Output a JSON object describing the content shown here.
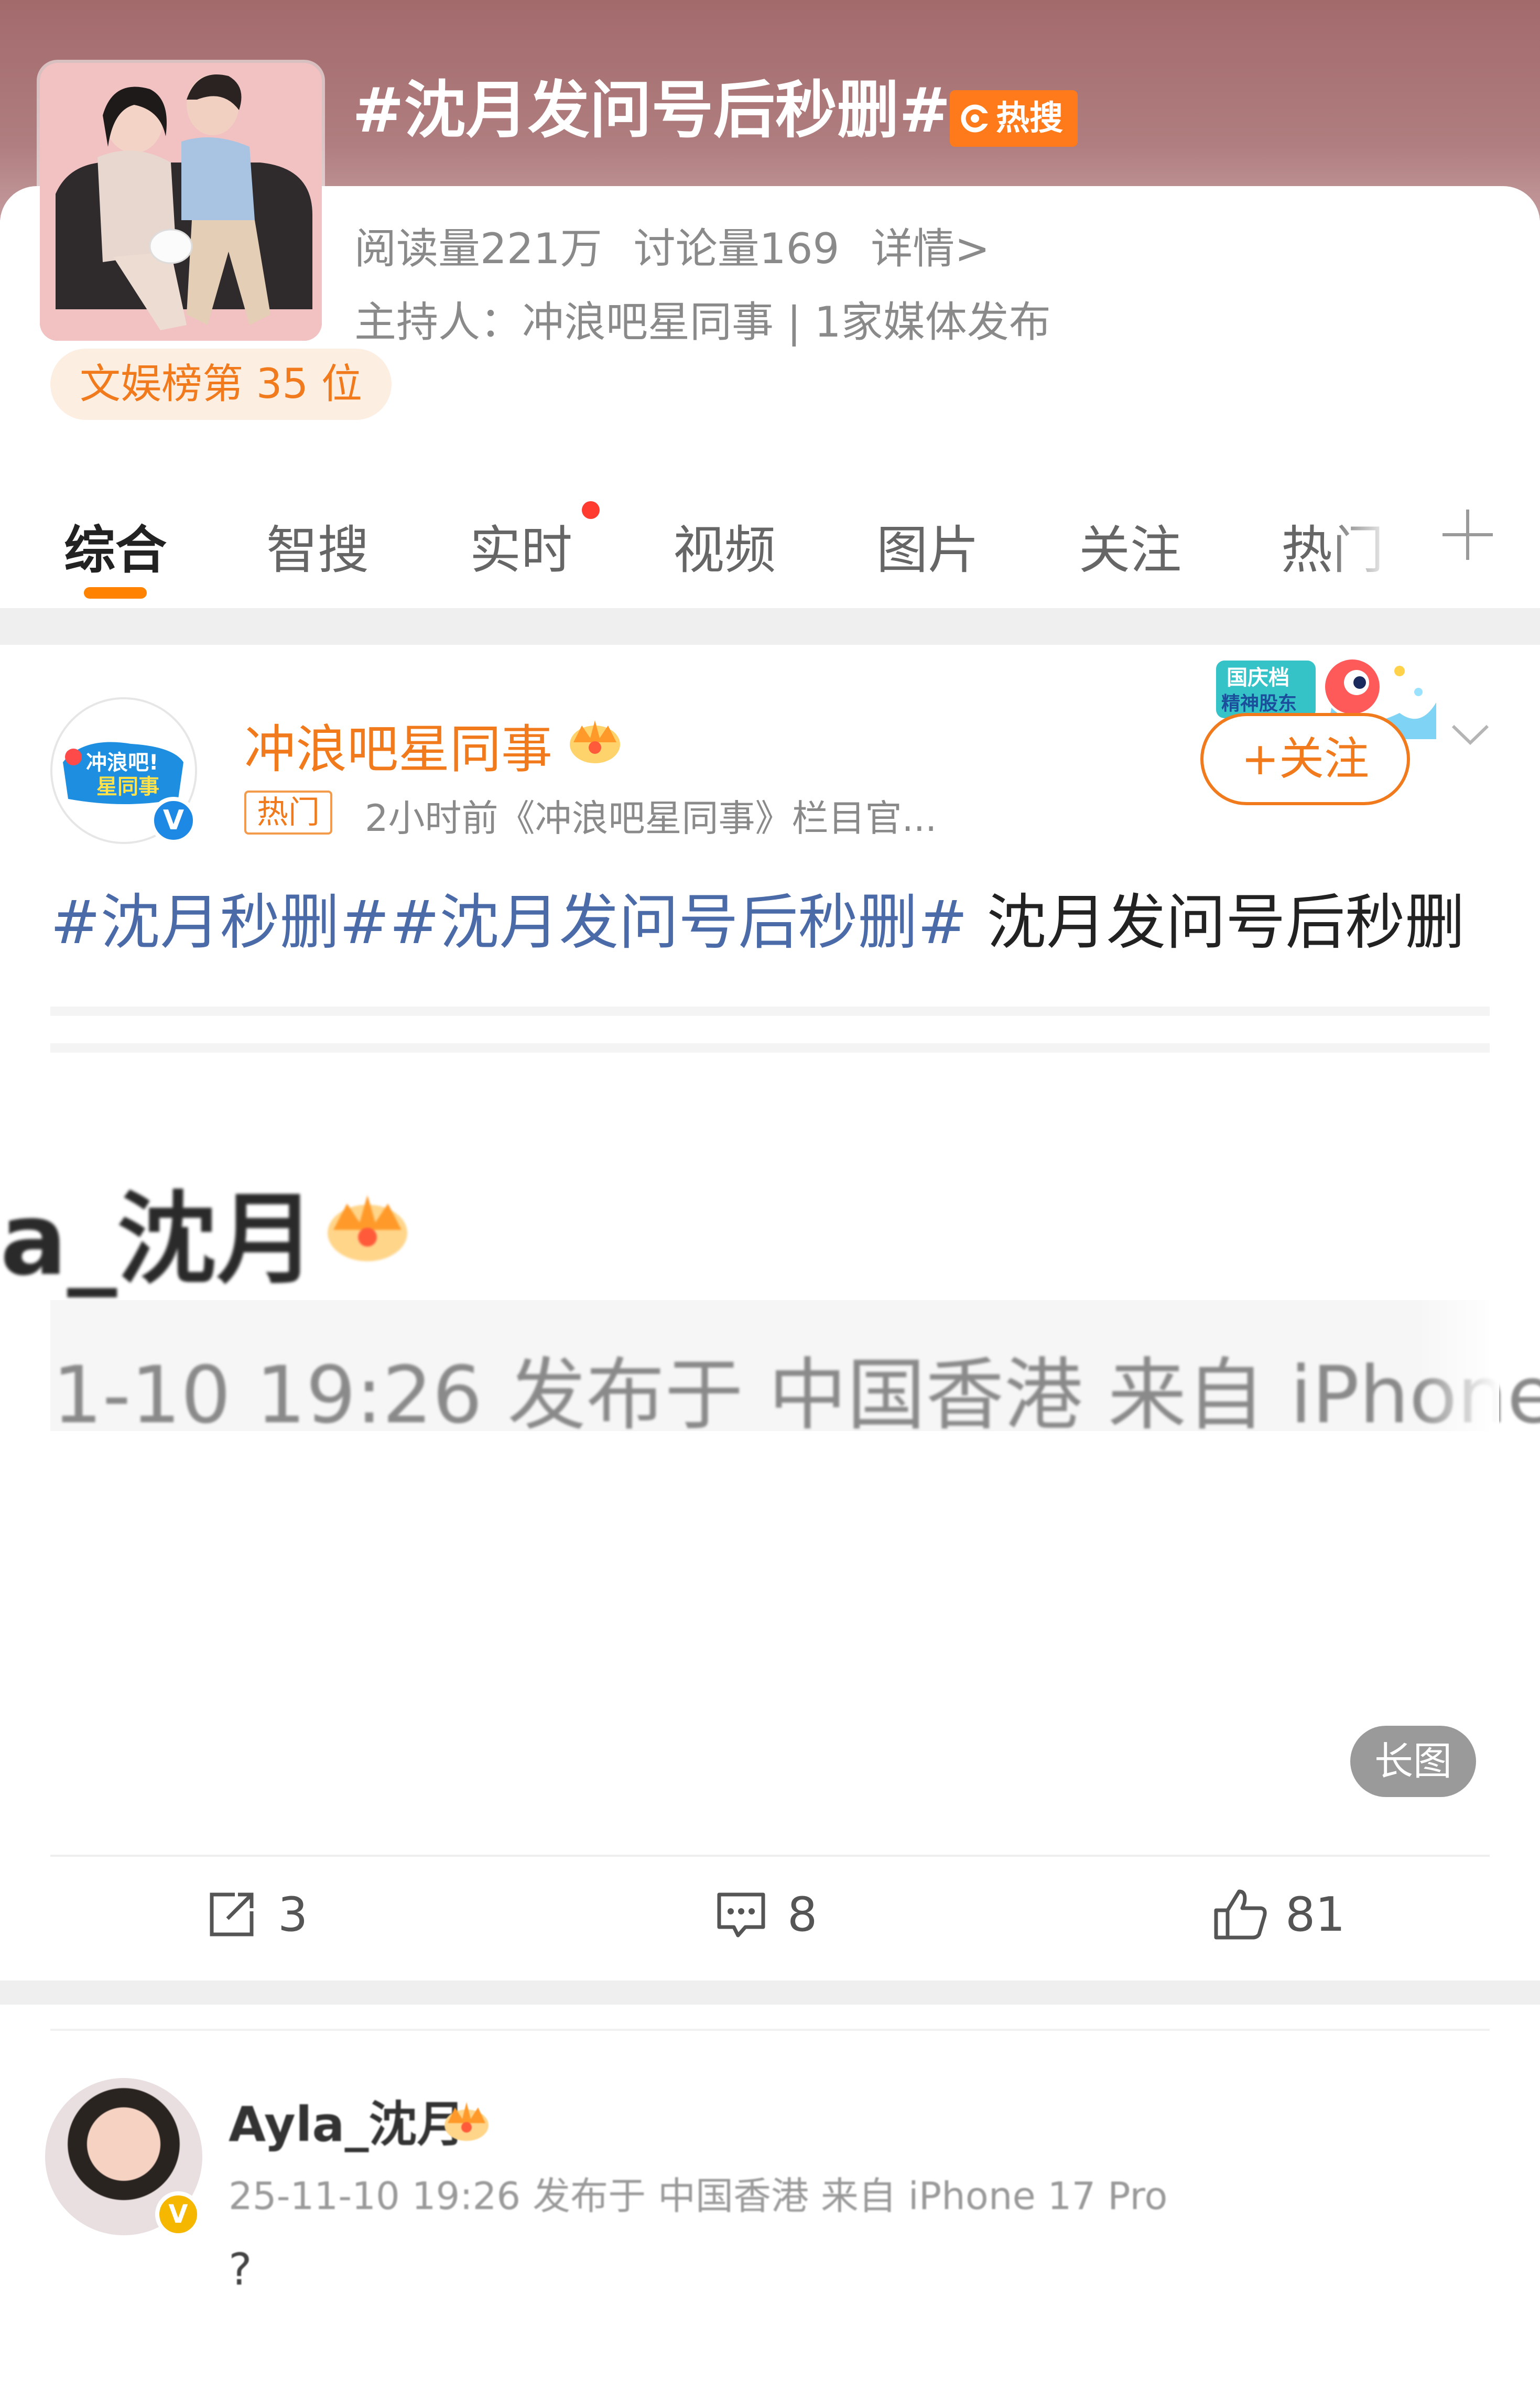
{
  "topic": {
    "title": "#沈月发问号后秒删#",
    "hot_badge": "热搜",
    "stats": {
      "reads": "阅读量221万",
      "discussions": "讨论量169",
      "details": "详情>"
    },
    "host_line": "主持人：冲浪吧星同事 | 1家媒体发布",
    "rank": "文娱榜第 35 位"
  },
  "tabs": [
    {
      "label": "综合",
      "active": true
    },
    {
      "label": "智搜"
    },
    {
      "label": "实时",
      "has_dot": true
    },
    {
      "label": "视频"
    },
    {
      "label": "图片"
    },
    {
      "label": "关注"
    },
    {
      "label": "热门"
    }
  ],
  "post1": {
    "author": "冲浪吧星同事",
    "hot_tag": "热门",
    "meta": "2小时前《冲浪吧星同事》栏目官...",
    "follow_label": "+关注",
    "text_tags": "#沈月秒删##沈月发问号后秒删#",
    "text_body": " 沈月发问号后秒删",
    "image": {
      "username": "a_沈月",
      "meta": "1-10 19:26 发布于 中国香港 来自 iPhone",
      "badge": "长图"
    },
    "actions": {
      "reposts": "3",
      "comments": "8",
      "likes": "81"
    },
    "avatar_text": [
      "冲浪吧!",
      "星同事"
    ],
    "activity_badge": [
      "国庆档",
      "精神股东"
    ]
  },
  "post2": {
    "author": "Ayla_沈月",
    "meta": "25-11-10 19:26 发布于 中国香港 来自 iPhone 17 Pro",
    "text": "?"
  },
  "colors": {
    "accent": "#ff8200",
    "hashtag": "#4a6aa8",
    "muted": "#8a8a8a"
  },
  "icons": [
    "hot-search-icon",
    "verified-icon",
    "crown-icon",
    "plus-icon",
    "chevron-down-icon",
    "repost-icon",
    "comment-icon",
    "like-icon"
  ]
}
